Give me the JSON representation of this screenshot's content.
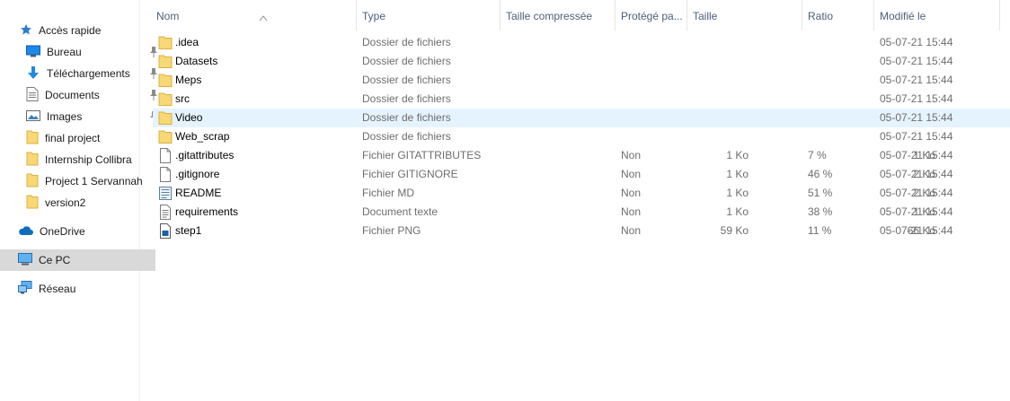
{
  "sidebar": {
    "quick_access": "Accès rapide",
    "items": [
      {
        "label": "Bureau",
        "icon": "desktop-icon",
        "pinned": true
      },
      {
        "label": "Téléchargements",
        "icon": "download-icon",
        "pinned": true
      },
      {
        "label": "Documents",
        "icon": "documents-icon",
        "pinned": true
      },
      {
        "label": "Images",
        "icon": "pictures-icon",
        "pinned": true
      },
      {
        "label": "final project",
        "icon": "folder-icon",
        "pinned": false
      },
      {
        "label": "Internship Collibra",
        "icon": "folder-icon",
        "pinned": false
      },
      {
        "label": "Project 1 Servannah",
        "icon": "folder-icon",
        "pinned": false
      },
      {
        "label": "version2",
        "icon": "folder-icon",
        "pinned": false
      }
    ],
    "onedrive": "OneDrive",
    "this_pc": "Ce PC",
    "network": "Réseau"
  },
  "columns": {
    "name": "Nom",
    "type": "Type",
    "compressed_size": "Taille compressée",
    "protected": "Protégé pa...",
    "size": "Taille",
    "ratio": "Ratio",
    "modified": "Modifié le"
  },
  "files": [
    {
      "name": ".idea",
      "icon": "folder-icon",
      "type": "Dossier de fichiers",
      "compressed_size": "",
      "protected": "",
      "size": "",
      "ratio": "",
      "modified": "05-07-21 15:44",
      "selected": false
    },
    {
      "name": "Datasets",
      "icon": "folder-icon",
      "type": "Dossier de fichiers",
      "compressed_size": "",
      "protected": "",
      "size": "",
      "ratio": "",
      "modified": "05-07-21 15:44",
      "selected": false
    },
    {
      "name": "Meps",
      "icon": "folder-icon",
      "type": "Dossier de fichiers",
      "compressed_size": "",
      "protected": "",
      "size": "",
      "ratio": "",
      "modified": "05-07-21 15:44",
      "selected": false
    },
    {
      "name": "src",
      "icon": "folder-icon",
      "type": "Dossier de fichiers",
      "compressed_size": "",
      "protected": "",
      "size": "",
      "ratio": "",
      "modified": "05-07-21 15:44",
      "selected": false
    },
    {
      "name": "Video",
      "icon": "folder-icon",
      "type": "Dossier de fichiers",
      "compressed_size": "",
      "protected": "",
      "size": "",
      "ratio": "",
      "modified": "05-07-21 15:44",
      "selected": true
    },
    {
      "name": "Web_scrap",
      "icon": "folder-icon",
      "type": "Dossier de fichiers",
      "compressed_size": "",
      "protected": "",
      "size": "",
      "ratio": "",
      "modified": "05-07-21 15:44",
      "selected": false
    },
    {
      "name": ".gitattributes",
      "icon": "file-icon",
      "type": "Fichier GITATTRIBUTES",
      "compressed_size": "1 Ko",
      "protected": "Non",
      "size": "1 Ko",
      "ratio": "7 %",
      "modified": "05-07-21 15:44",
      "selected": false
    },
    {
      "name": ".gitignore",
      "icon": "file-icon",
      "type": "Fichier GITIGNORE",
      "compressed_size": "1 Ko",
      "protected": "Non",
      "size": "2 Ko",
      "ratio": "46 %",
      "modified": "05-07-21 15:44",
      "selected": false
    },
    {
      "name": "README",
      "icon": "markdown-file-icon",
      "type": "Fichier MD",
      "compressed_size": "1 Ko",
      "protected": "Non",
      "size": "2 Ko",
      "ratio": "51 %",
      "modified": "05-07-21 15:44",
      "selected": false
    },
    {
      "name": "requirements",
      "icon": "text-file-icon",
      "type": "Document texte",
      "compressed_size": "1 Ko",
      "protected": "Non",
      "size": "1 Ko",
      "ratio": "38 %",
      "modified": "05-07-21 15:44",
      "selected": false
    },
    {
      "name": "step1",
      "icon": "image-file-icon",
      "type": "Fichier PNG",
      "compressed_size": "59 Ko",
      "protected": "Non",
      "size": "66 Ko",
      "ratio": "11 %",
      "modified": "05-07-21 15:44",
      "selected": false
    }
  ],
  "colors": {
    "selected_row": "#e5f3ff",
    "selected_nav": "#d9d9d9",
    "folder": "#f8d775",
    "header_text": "#4c607a"
  }
}
